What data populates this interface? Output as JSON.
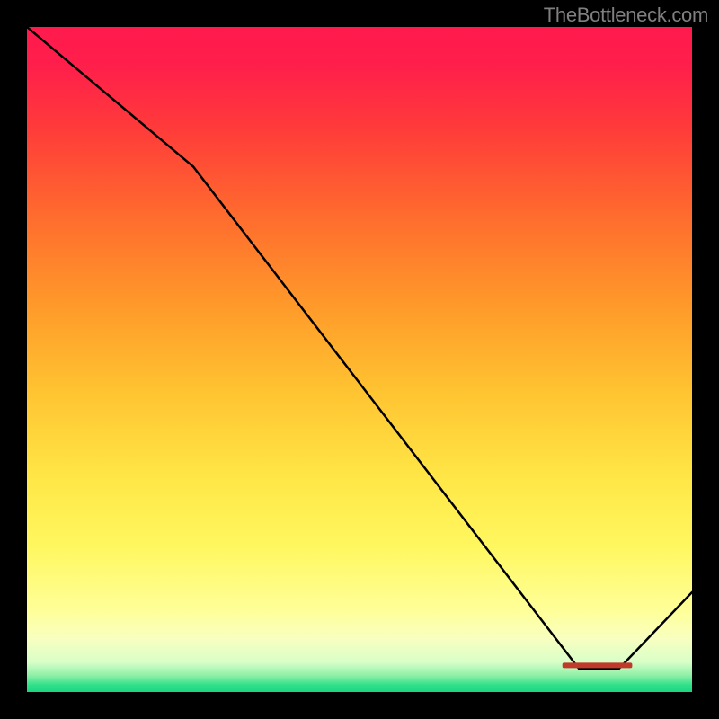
{
  "watermark": "TheBottleneck.com",
  "chart_data": {
    "type": "line",
    "title": "",
    "xlabel": "",
    "ylabel": "",
    "xlim": [
      0,
      100
    ],
    "ylim": [
      0,
      100
    ],
    "gradient": {
      "stops": [
        {
          "offset": 0.0,
          "color": "#ff1a4d"
        },
        {
          "offset": 0.06,
          "color": "#ff1f4b"
        },
        {
          "offset": 0.15,
          "color": "#ff3a3a"
        },
        {
          "offset": 0.28,
          "color": "#ff6a2e"
        },
        {
          "offset": 0.42,
          "color": "#ff9a2a"
        },
        {
          "offset": 0.55,
          "color": "#ffc431"
        },
        {
          "offset": 0.68,
          "color": "#ffe747"
        },
        {
          "offset": 0.78,
          "color": "#fff75f"
        },
        {
          "offset": 0.88,
          "color": "#ffff9a"
        },
        {
          "offset": 0.92,
          "color": "#f8ffc0"
        },
        {
          "offset": 0.955,
          "color": "#d8ffc8"
        },
        {
          "offset": 0.975,
          "color": "#8ef0a8"
        },
        {
          "offset": 0.99,
          "color": "#2ee088"
        },
        {
          "offset": 1.0,
          "color": "#1dd580"
        }
      ]
    },
    "series": [
      {
        "name": "curve",
        "x": [
          0,
          25,
          83,
          89,
          100
        ],
        "y": [
          100,
          79,
          3.5,
          3.5,
          15
        ]
      }
    ],
    "bar_segment": {
      "x_start": 80.5,
      "x_end": 91.0,
      "y": 4.0,
      "label": "",
      "color": "#c0392b"
    }
  },
  "colors": {
    "background": "#000000",
    "watermark": "#808080",
    "curve": "#000000",
    "bar": "#c0392b"
  }
}
